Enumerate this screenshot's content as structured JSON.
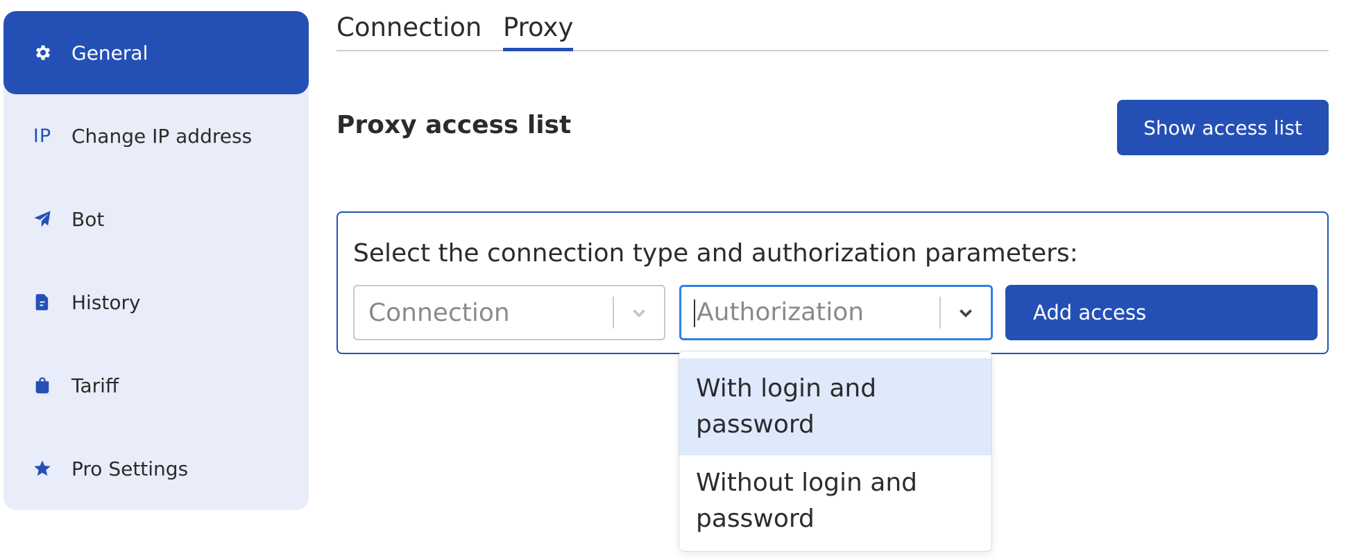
{
  "sidebar": {
    "items": [
      {
        "label": "General",
        "icon": "gear-icon",
        "active": true
      },
      {
        "label": "Change IP address",
        "icon": "ip-icon",
        "icon_text": "IP"
      },
      {
        "label": "Bot",
        "icon": "paper-plane-icon"
      },
      {
        "label": "History",
        "icon": "document-icon"
      },
      {
        "label": "Tariff",
        "icon": "shopping-bag-icon"
      },
      {
        "label": "Pro Settings",
        "icon": "star-icon"
      }
    ]
  },
  "tabs": [
    {
      "label": "Connection",
      "active": false
    },
    {
      "label": "Proxy",
      "active": true
    }
  ],
  "main": {
    "section_title": "Proxy access list",
    "show_button": "Show access list",
    "card": {
      "label": "Select the connection type and authorization parameters:",
      "connection_select": {
        "placeholder": "Connection"
      },
      "authorization_select": {
        "placeholder": "Authorization",
        "focused": true
      },
      "add_button": "Add access"
    },
    "dropdown": {
      "options": [
        {
          "label": "With login and password",
          "highlighted": true
        },
        {
          "label": "Without login and password",
          "highlighted": false
        }
      ]
    }
  },
  "colors": {
    "accent": "#2450b6",
    "sidebar_bg": "#e8edf9",
    "focus_border": "#2c80ea",
    "option_highlight": "#dfe9fc"
  }
}
